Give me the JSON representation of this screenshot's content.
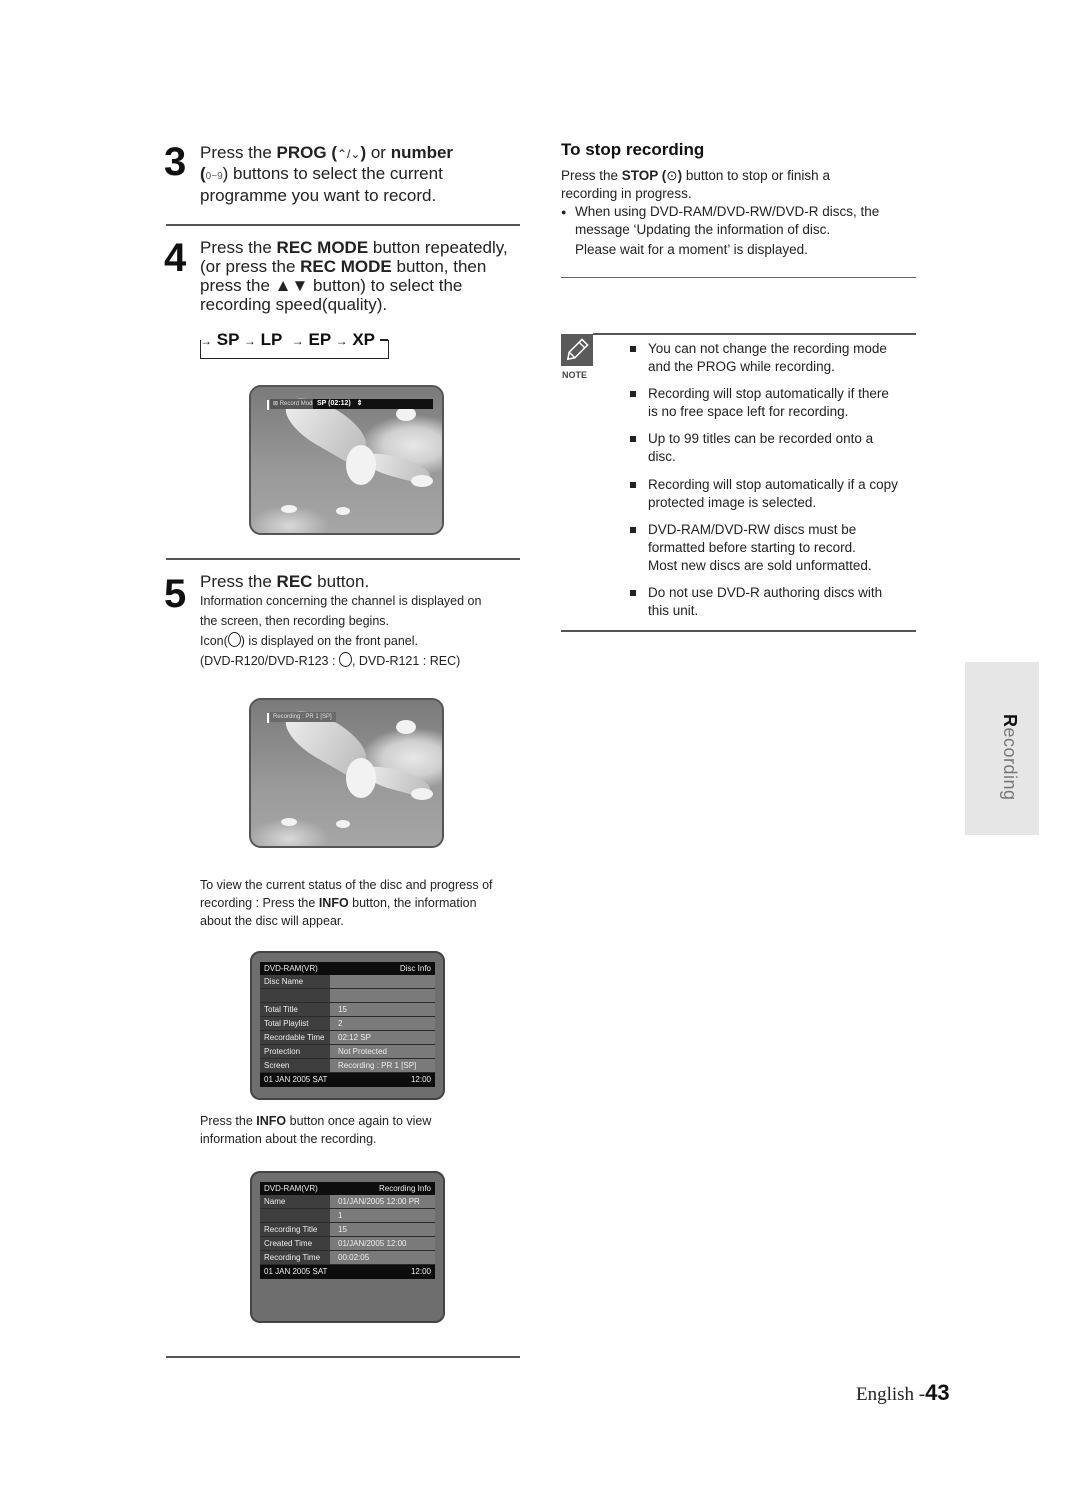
{
  "steps": {
    "step3": {
      "number": "3",
      "line1_pre": "Press the ",
      "line1_bold": "PROG (",
      "line1_icons": "⌃/⌄",
      "line1_bold2": ") ",
      "line1_mid": "or ",
      "line1_bold3": "number",
      "line2_open": "(",
      "line2_icons": "0~9",
      "line2_rest": ") buttons to select the current",
      "line3": "programme you want to record."
    },
    "step4": {
      "number": "4",
      "line1_pre": "Press the ",
      "line1_bold": "REC MODE",
      "line1_post": " button repeatedly,",
      "line2_pre": "(or press the ",
      "line2_bold": "REC MODE",
      "line2_post": " button, then",
      "line3_pre": "press the ",
      "line3_bold": "▲▼",
      "line3_post": " button) to select the",
      "line4": "recording speed(quality).",
      "cycle": [
        "SP",
        "LP",
        "EP",
        "XP"
      ],
      "arrow": "→"
    },
    "step5": {
      "number": "5",
      "line1_pre": "Press the ",
      "line1_bold": "REC",
      "line1_post": " button.",
      "desc1": "Information concerning the channel is displayed on",
      "desc2": "the screen, then recording begins.",
      "desc3_pre": "Icon(",
      "desc3_post": ") is displayed on the front panel.",
      "desc4_pre": "(DVD-R120/DVD-R123 : ",
      "desc4_post": ", DVD-R121 : REC)"
    }
  },
  "screens": {
    "record_mode": {
      "label": "Record Mode",
      "value": "SP (02:12)",
      "arrows": "⇕"
    },
    "recording": {
      "label": "Recording : PR 1  [SP]"
    }
  },
  "info_paragraph": {
    "pre": "To view the current status of the disc and progress of",
    "line2_pre": "recording : Press the ",
    "line2_bold": "INFO",
    "line2_post": " button, the information",
    "line3": "about the disc will appear."
  },
  "disc_info": {
    "header_left": "DVD-RAM(VR)",
    "header_right": "Disc Info",
    "rows": [
      {
        "key": "Disc Name",
        "value": ""
      },
      {
        "key": "",
        "value": ""
      },
      {
        "key": "Total Title",
        "value": "15"
      },
      {
        "key": "Total Playlist",
        "value": "2"
      },
      {
        "key": "Recordable Time",
        "value": "02:12  SP"
      },
      {
        "key": "Protection",
        "value": "Not Protected"
      },
      {
        "key": "Screen",
        "value": "Recording :  PR 1 [SP]"
      }
    ],
    "footer_left": "01 JAN 2005 SAT",
    "footer_right": "12:00"
  },
  "info_again_paragraph": {
    "line1_pre": "Press the ",
    "line1_bold": "INFO",
    "line1_post": " button once again to view",
    "line2": "information about the recording."
  },
  "recording_info": {
    "header_left": "DVD-RAM(VR)",
    "header_right": "Recording Info",
    "rows": [
      {
        "key": "Name",
        "value": "01/JAN/2005 12:00 PR"
      },
      {
        "key": "",
        "value": "1"
      },
      {
        "key": "Recording Title",
        "value": "15"
      },
      {
        "key": "Created Time",
        "value": "01/JAN/2005 12:00"
      },
      {
        "key": "Recording Time",
        "value": "00:02:05"
      }
    ],
    "footer_left": "01 JAN 2005 SAT",
    "footer_right": "12:00"
  },
  "stop_section": {
    "title": "To stop recording",
    "line1_pre": "Press the ",
    "line1_bold": "STOP (",
    "line1_icon": "⊙",
    "line1_bold2": ")",
    "line1_post": " button to stop or finish a",
    "line2": "recording in progress.",
    "bullet": "●",
    "bullet_line1": "When using DVD-RAM/DVD-RW/DVD-R discs, the",
    "bullet_line2": "message ‘Updating the information of disc.",
    "bullet_line3": "Please wait for a moment’ is displayed."
  },
  "note": {
    "label": "NOTE",
    "items": [
      {
        "l1": "You can not change the recording mode",
        "l2": "and the PROG while recording.",
        "l3": ""
      },
      {
        "l1": "Recording will stop automatically if there",
        "l2": "is no free space left for recording.",
        "l3": ""
      },
      {
        "l1": "Up to 99 titles can be recorded onto a",
        "l2": "disc.",
        "l3": ""
      },
      {
        "l1": "Recording will stop automatically if a copy",
        "l2": "protected image is selected.",
        "l3": ""
      },
      {
        "l1": "DVD-RAM/DVD-RW discs must be",
        "l2": "formatted before starting to record.",
        "l3": "Most new discs are sold unformatted."
      },
      {
        "l1": "Do not use DVD-R authoring discs with",
        "l2": "this unit.",
        "l3": ""
      }
    ]
  },
  "side_tab": {
    "first": "R",
    "rest": "ecording"
  },
  "footer": {
    "language": "English -",
    "page": "43"
  }
}
